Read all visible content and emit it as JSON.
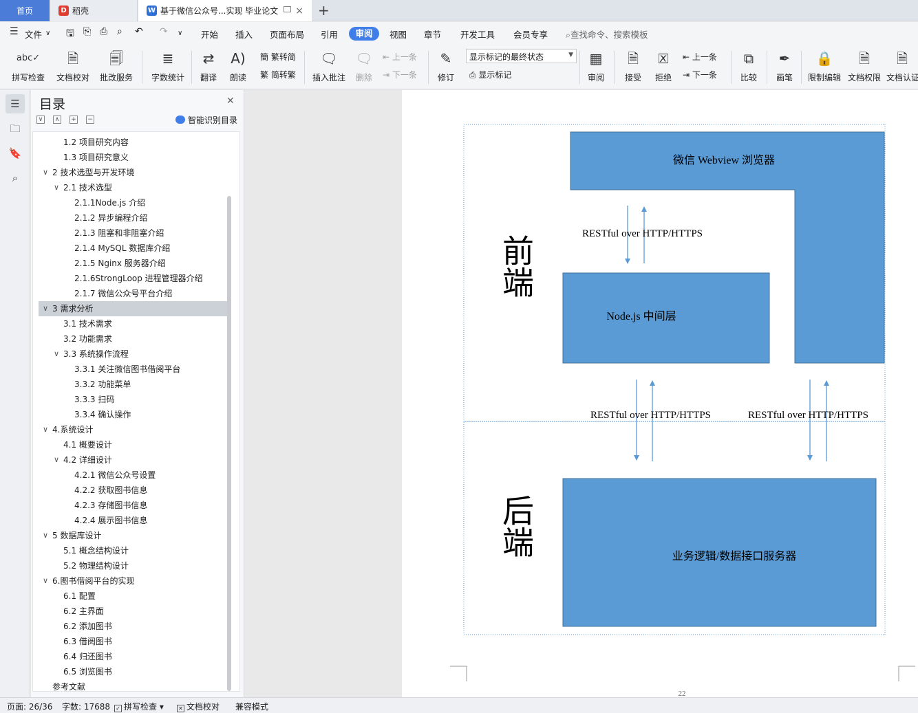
{
  "tabs": {
    "home": "首页",
    "daoke": "稻壳",
    "doc": "基于微信公众号...实现 毕业论文",
    "add": "+",
    "close": "×"
  },
  "menu": {
    "file": "文件",
    "items": [
      "开始",
      "插入",
      "页面布局",
      "引用",
      "审阅",
      "视图",
      "章节",
      "开发工具",
      "会员专享"
    ],
    "active": "审阅",
    "search_placeholder": "查找命令、搜索模板"
  },
  "ribbon": {
    "spellcheck": "拼写检查",
    "doc_proof": "文档校对",
    "correction_service": "批改服务",
    "word_count": "字数统计",
    "translate": "翻译",
    "read_aloud": "朗读",
    "trad_to_simp": "繁转简",
    "simp_to_trad": "简转繁",
    "insert_comment": "插入批注",
    "delete": "删除",
    "prev": "上一条",
    "next": "下一条",
    "markup_state": "显示标记的最终状态",
    "track_changes": "修订",
    "show_markup": "显示标记",
    "review": "审阅",
    "accept": "接受",
    "reject": "拒绝",
    "prev2": "上一条",
    "next2": "下一条",
    "compare": "比较",
    "pen": "画笔",
    "restrict_edit": "限制编辑",
    "doc_permission": "文档权限",
    "doc_auth": "文档认证"
  },
  "toc": {
    "title": "目录",
    "smart": "智能识别目录",
    "items": [
      {
        "text": "1.2 项目研究内容",
        "level": 2
      },
      {
        "text": "1.3 项目研究意义",
        "level": 2
      },
      {
        "text": "2 技术选型与开发环境",
        "level": 1,
        "expanded": true
      },
      {
        "text": "2.1 技术选型",
        "level": 2,
        "expanded": true
      },
      {
        "text": "2.1.1Node.js 介绍",
        "level": 3
      },
      {
        "text": "2.1.2 异步编程介绍",
        "level": 3
      },
      {
        "text": "2.1.3 阻塞和非阻塞介绍",
        "level": 3
      },
      {
        "text": "2.1.4 MySQL 数据库介绍",
        "level": 3
      },
      {
        "text": "2.1.5 Nginx 服务器介绍",
        "level": 3
      },
      {
        "text": "2.1.6StrongLoop 进程管理器介绍",
        "level": 3
      },
      {
        "text": "2.1.7 微信公众号平台介绍",
        "level": 3
      },
      {
        "text": "3 需求分析",
        "level": 1,
        "expanded": true,
        "selected": true
      },
      {
        "text": "3.1 技术需求",
        "level": 2
      },
      {
        "text": "3.2 功能需求",
        "level": 2
      },
      {
        "text": "3.3 系统操作流程",
        "level": 2,
        "expanded": true
      },
      {
        "text": "3.3.1 关注微信图书借阅平台",
        "level": 3
      },
      {
        "text": "3.3.2 功能菜单",
        "level": 3
      },
      {
        "text": "3.3.3 扫码",
        "level": 3
      },
      {
        "text": "3.3.4 确认操作",
        "level": 3
      },
      {
        "text": "4.系统设计",
        "level": 1,
        "expanded": true
      },
      {
        "text": "4.1 概要设计",
        "level": 2
      },
      {
        "text": "4.2 详细设计",
        "level": 2,
        "expanded": true
      },
      {
        "text": "4.2.1 微信公众号设置",
        "level": 3
      },
      {
        "text": "4.2.2 获取图书信息",
        "level": 3
      },
      {
        "text": "4.2.3 存储图书信息",
        "level": 3
      },
      {
        "text": "4.2.4 展示图书信息",
        "level": 3
      },
      {
        "text": "5 数据库设计",
        "level": 1,
        "expanded": true
      },
      {
        "text": "5.1 概念结构设计",
        "level": 2
      },
      {
        "text": "5.2 物理结构设计",
        "level": 2
      },
      {
        "text": "6.图书借阅平台的实现",
        "level": 1,
        "expanded": true
      },
      {
        "text": "6.1 配置",
        "level": 2
      },
      {
        "text": "6.2 主界面",
        "level": 2
      },
      {
        "text": "6.2 添加图书",
        "level": 2
      },
      {
        "text": "6.3 借阅图书",
        "level": 2
      },
      {
        "text": "6.4 归还图书",
        "level": 2
      },
      {
        "text": "6.5 浏览图书",
        "level": 2
      },
      {
        "text": "参考文献",
        "level": 1
      }
    ]
  },
  "diagram": {
    "frontend_label": "前端",
    "backend_label": "后端",
    "webview": "微信 Webview 浏览器",
    "nodejs": "Node.js 中间层",
    "service": "业务逻辑/数据接口服务器",
    "restful": "RESTful over HTTP/HTTPS",
    "page_number": "22"
  },
  "status": {
    "page": "页面: 26/36",
    "words": "字数: 17688",
    "spell": "拼写检查",
    "proof": "文档校对",
    "compat": "兼容模式"
  },
  "colors": {
    "accent": "#3f7ee8",
    "box_fill": "#5b9bd5",
    "box_stroke": "#41719c"
  }
}
